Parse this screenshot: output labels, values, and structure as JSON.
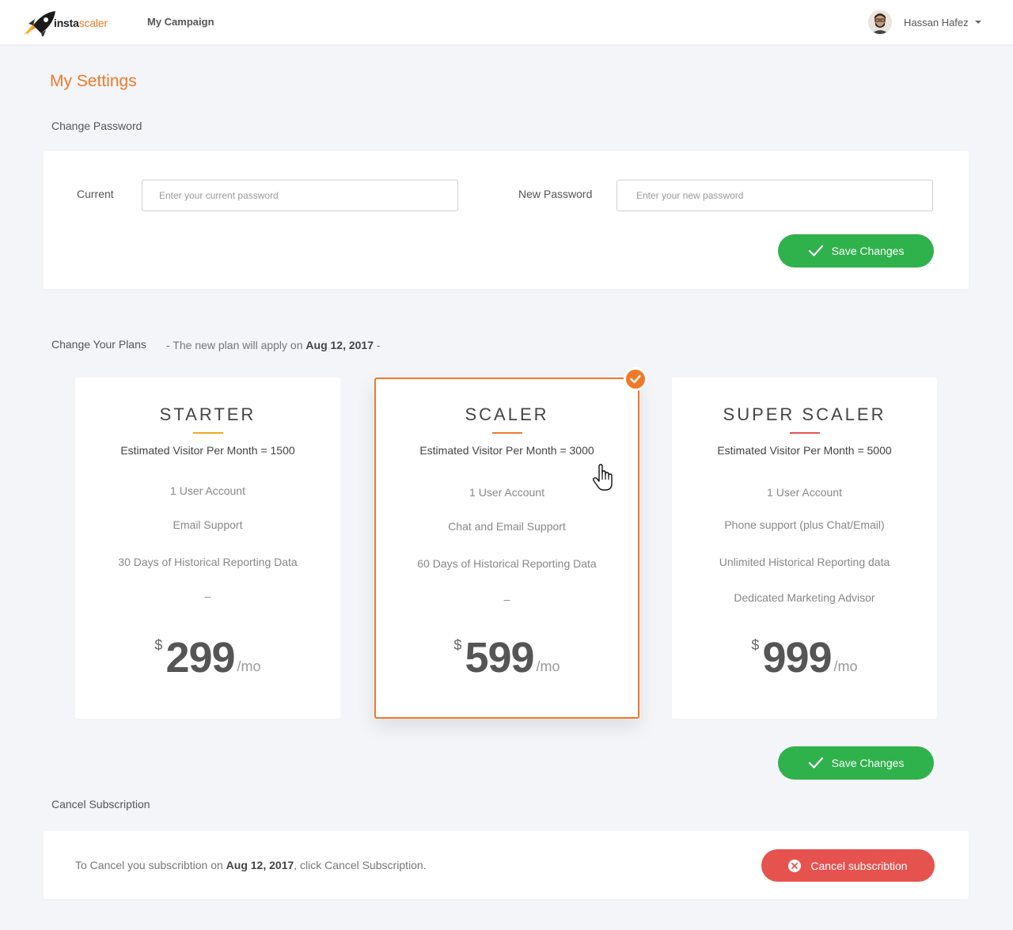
{
  "header": {
    "logo_part1": "insta",
    "logo_part2": "scaler",
    "nav_link": "My Campaign",
    "user_name": "Hassan Hafez"
  },
  "page": {
    "title": "My Settings"
  },
  "password_section": {
    "heading": "Change Password",
    "current_label": "Current",
    "current_placeholder": "Enter your current password",
    "new_label": "New Password",
    "new_placeholder": "Enter your new password",
    "save_label": "Save Changes"
  },
  "plans_section": {
    "heading": "Change Your Plans",
    "note_prefix": "- The new plan will apply on",
    "note_date": "Aug 12, 2017",
    "note_suffix": "-",
    "save_label": "Save Changes",
    "selected_plan": "SCALER",
    "plans": [
      {
        "name": "STARTER",
        "accent": "#f0a81c",
        "visitors": "Estimated Visitor Per Month = 1500",
        "features": [
          "1 User Account",
          "Email Support",
          "30 Days of Historical Reporting Data",
          "–"
        ],
        "currency": "$",
        "price": "299",
        "period": "/mo"
      },
      {
        "name": "SCALER",
        "accent": "#f07a2a",
        "visitors": "Estimated Visitor Per Month = 3000",
        "features": [
          "1 User Account",
          "Chat and Email Support",
          "60 Days of Historical Reporting Data",
          "–"
        ],
        "currency": "$",
        "price": "599",
        "period": "/mo"
      },
      {
        "name": "SUPER SCALER",
        "accent": "#e6534f",
        "visitors": "Estimated Visitor Per Month = 5000",
        "features": [
          "1 User Account",
          "Phone support (plus Chat/Email)",
          "Unlimited Historical Reporting data",
          "Dedicated Marketing Advisor"
        ],
        "currency": "$",
        "price": "999",
        "period": "/mo"
      }
    ]
  },
  "cancel_section": {
    "heading": "Cancel Subscription",
    "text_prefix": "To Cancel you subscribtion on",
    "text_date": "Aug 12, 2017",
    "text_suffix": ", click Cancel Subscription.",
    "button_label": "Cancel subscribtion"
  },
  "colors": {
    "brand_orange": "#f07a2a",
    "success_green": "#2fb24b",
    "danger_red": "#e6534f",
    "background": "#f4f5f9"
  }
}
